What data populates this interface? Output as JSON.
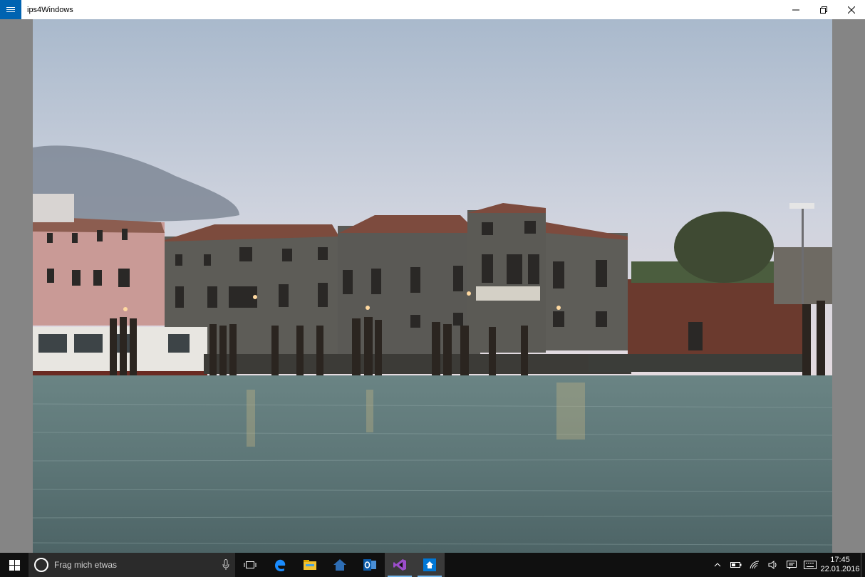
{
  "app": {
    "title": "ips4Windows"
  },
  "window_controls": {
    "minimize": "minimize-icon",
    "restore": "restore-icon",
    "close": "close-icon"
  },
  "colors": {
    "accent": "#0063b1",
    "taskbar": "#101010",
    "stage": "#858585"
  },
  "photo": {
    "subject": "Venice canal buildings at dusk"
  },
  "taskbar": {
    "search_placeholder": "Frag mich etwas",
    "apps": [
      {
        "name": "task-view-icon"
      },
      {
        "name": "edge-icon"
      },
      {
        "name": "file-explorer-icon"
      },
      {
        "name": "home-icon"
      },
      {
        "name": "outlook-icon"
      },
      {
        "name": "visual-studio-icon"
      },
      {
        "name": "ips4windows-icon"
      }
    ],
    "tray": {
      "time": "17:45",
      "date": "22.01.2016"
    }
  }
}
